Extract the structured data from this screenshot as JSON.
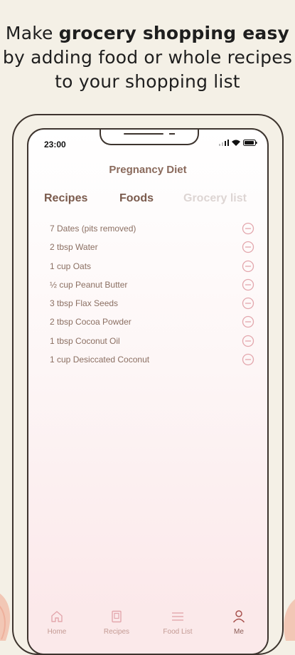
{
  "headline": {
    "prefix": "Make ",
    "bold": "grocery shopping easy",
    "suffix": " by adding food or whole recipes to your shopping list"
  },
  "status_bar": {
    "time": "23:00"
  },
  "app": {
    "title": "Pregnancy Diet",
    "tabs": [
      {
        "label": "Recipes",
        "active": false
      },
      {
        "label": "Foods",
        "active": false
      },
      {
        "label": "Grocery list",
        "active": true
      }
    ]
  },
  "grocery_list": [
    "7 Dates (pits removed)",
    "2 tbsp Water",
    "1 cup Oats",
    "½ cup Peanut Butter",
    "3 tbsp Flax Seeds",
    "2 tbsp Cocoa Powder",
    "1 tbsp Coconut Oil",
    "1 cup Desiccated Coconut"
  ],
  "bottom_nav": [
    {
      "label": "Home",
      "icon": "home-icon"
    },
    {
      "label": "Recipes",
      "icon": "book-icon"
    },
    {
      "label": "Food List",
      "icon": "list-icon"
    },
    {
      "label": "Me",
      "icon": "person-icon"
    }
  ],
  "colors": {
    "background": "#f4f0e6",
    "accent": "#8a6a5c",
    "remove_icon": "#e3a7ad",
    "nav_bg": "#fbe9ea"
  }
}
